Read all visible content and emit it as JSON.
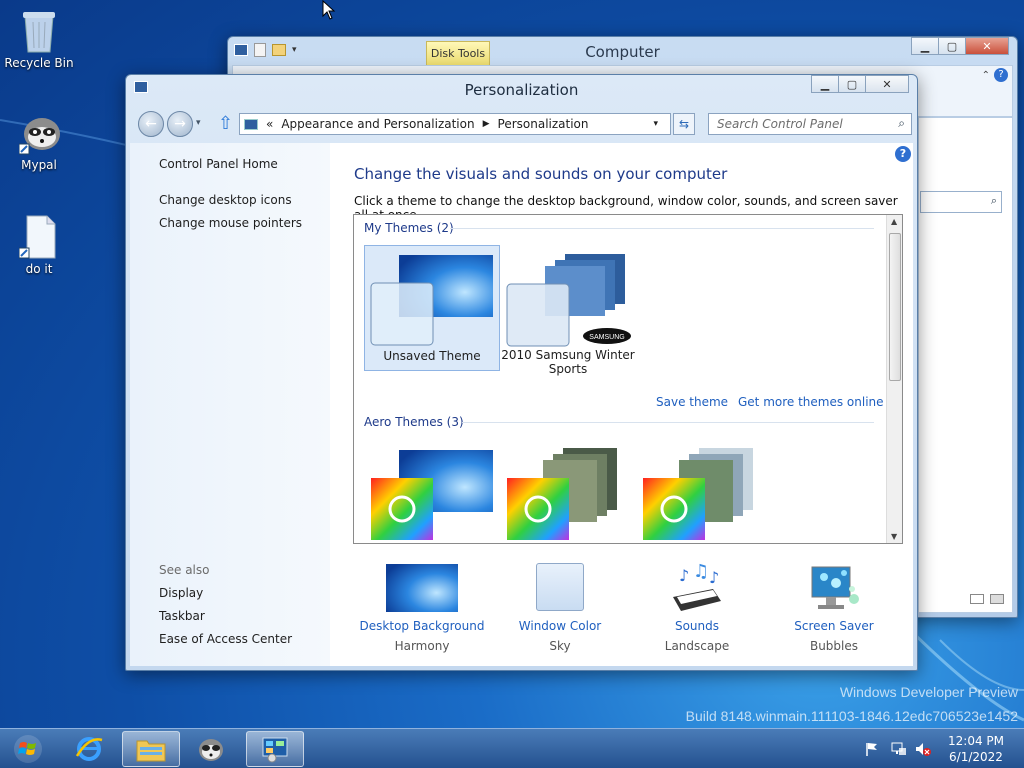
{
  "desktop": {
    "icons": [
      {
        "label": "Recycle Bin"
      },
      {
        "label": "Mypal"
      },
      {
        "label": "do it"
      }
    ],
    "watermark_line1": "Windows Developer Preview",
    "watermark_line2": "Build 8148.winmain.111103-1846.12edc706523e1452"
  },
  "computer_window": {
    "title": "Computer",
    "contextual_tab": "Disk Tools"
  },
  "personalization_window": {
    "title": "Personalization",
    "breadcrumb": {
      "overflow": "«",
      "items": [
        "Appearance and Personalization",
        "Personalization"
      ]
    },
    "search_placeholder": "Search Control Panel",
    "left_pane": {
      "home": "Control Panel Home",
      "links": [
        "Change desktop icons",
        "Change mouse pointers"
      ],
      "see_also_label": "See also",
      "see_also": [
        "Display",
        "Taskbar",
        "Ease of Access Center"
      ]
    },
    "heading": "Change the visuals and sounds on your computer",
    "subtext": "Click a theme to change the desktop background, window color, sounds, and screen saver all at once.",
    "my_themes_header": "My Themes (2)",
    "my_themes": [
      "Unsaved Theme",
      "2010 Samsung Winter Sports"
    ],
    "save_theme": "Save theme",
    "get_more": "Get more themes online",
    "aero_themes_header": "Aero Themes (3)",
    "bottom": [
      {
        "label": "Desktop Background",
        "value": "Harmony"
      },
      {
        "label": "Window Color",
        "value": "Sky"
      },
      {
        "label": "Sounds",
        "value": "Landscape"
      },
      {
        "label": "Screen Saver",
        "value": "Bubbles"
      }
    ]
  },
  "taskbar": {
    "time": "12:04 PM",
    "date": "6/1/2022"
  },
  "colors": {
    "link": "#1f5fbf",
    "heading": "#1e3a8a",
    "taskbar": "#2f5f9f"
  }
}
